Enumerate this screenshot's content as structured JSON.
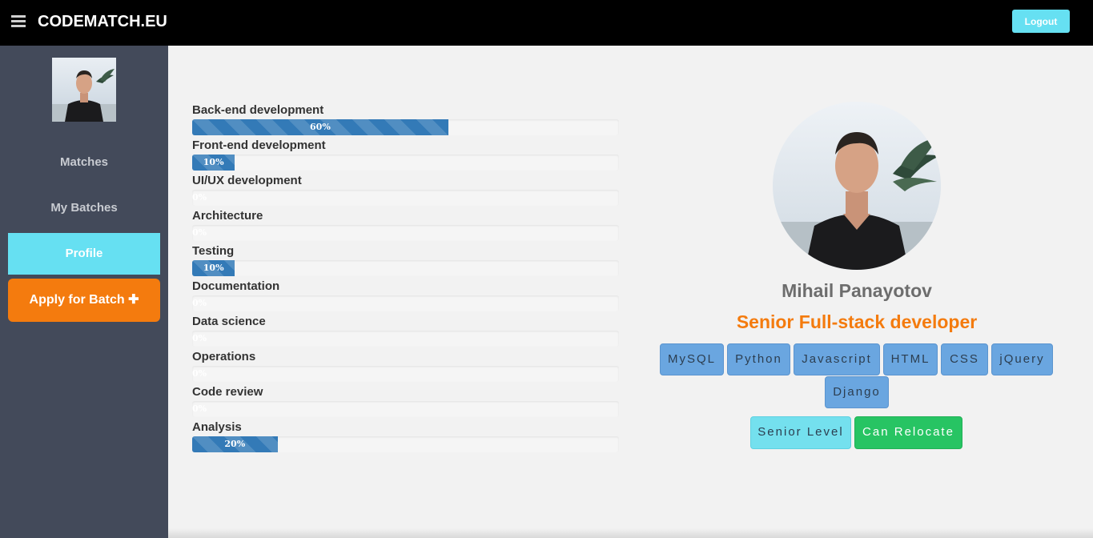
{
  "navbar": {
    "brand": "CODEMATCH.EU",
    "logout_label": "Logout"
  },
  "sidebar": {
    "items": [
      {
        "label": "Matches"
      },
      {
        "label": "My Batches"
      },
      {
        "label": "Profile"
      }
    ],
    "apply_label": "Apply for Batch ✚"
  },
  "skills": [
    {
      "label": "Back-end development",
      "percent": 60,
      "percent_text": "60%"
    },
    {
      "label": "Front-end development",
      "percent": 10,
      "percent_text": "10%"
    },
    {
      "label": "UI/UX development",
      "percent": 0,
      "percent_text": "0%"
    },
    {
      "label": "Architecture",
      "percent": 0,
      "percent_text": "0%"
    },
    {
      "label": "Testing",
      "percent": 10,
      "percent_text": "10%"
    },
    {
      "label": "Documentation",
      "percent": 0,
      "percent_text": "0%"
    },
    {
      "label": "Data science",
      "percent": 0,
      "percent_text": "0%"
    },
    {
      "label": "Operations",
      "percent": 0,
      "percent_text": "0%"
    },
    {
      "label": "Code review",
      "percent": 0,
      "percent_text": "0%"
    },
    {
      "label": "Analysis",
      "percent": 20,
      "percent_text": "20%"
    }
  ],
  "profile": {
    "name": "Mihail Panayotov",
    "title": "Senior Full-stack developer",
    "technologies": [
      "MySQL",
      "Python",
      "Javascript",
      "HTML",
      "CSS",
      "jQuery",
      "Django"
    ],
    "level_badge": "Senior Level",
    "relocate_badge": "Can Relocate"
  },
  "colors": {
    "accent_cyan": "#66e0f2",
    "accent_orange": "#f47b0e",
    "progress_blue": "#337ab7",
    "relocate_green": "#27c463"
  }
}
